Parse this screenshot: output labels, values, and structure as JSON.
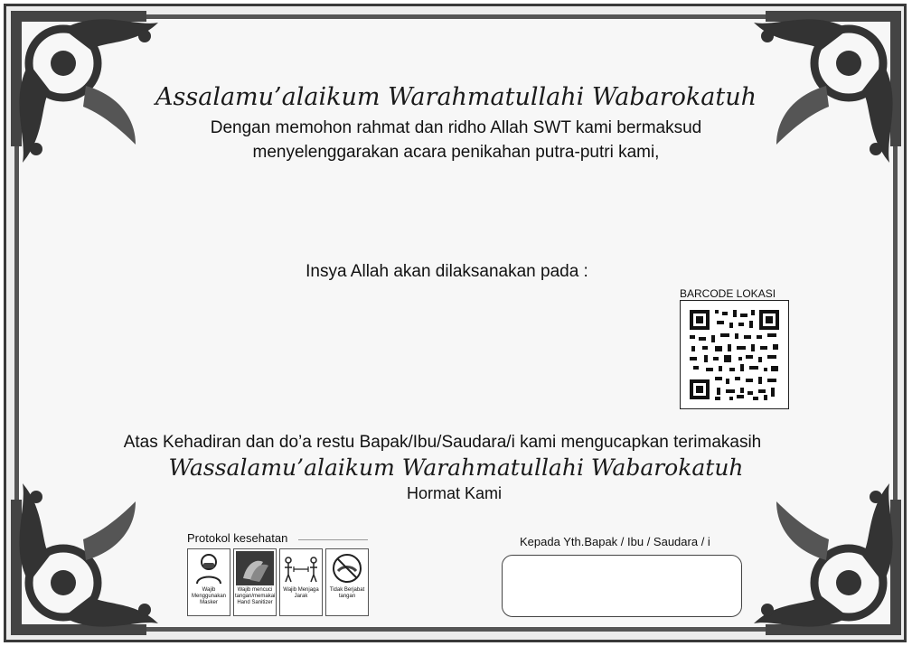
{
  "greeting_open": "Assalamu’alaikum Warahmatullahi Wabarokatuh",
  "intro_line1": "Dengan memohon rahmat dan ridho Allah SWT kami bermaksud",
  "intro_line2": "menyelenggarakan acara penikahan putra-putri kami,",
  "schedule_intro": "Insya Allah akan dilaksanakan pada :",
  "barcode": {
    "label": "BARCODE LOKASI"
  },
  "closing_line": "Atas Kehadiran dan do’a restu Bapak/Ibu/Saudara/i kami mengucapkan terimakasih",
  "greeting_close": "Wassalamu’alaikum Warahmatullahi Wabarokatuh",
  "signoff": "Hormat Kami",
  "protocol": {
    "title": "Protokol kesehatan",
    "items": [
      {
        "icon": "mask-icon",
        "caption": "Wajib Menggunakan Masker"
      },
      {
        "icon": "handwash-icon",
        "caption": "Wajib mencuci tangan/memakai Hand Sanitizer"
      },
      {
        "icon": "distance-icon",
        "caption": "Wajib Menjaga Jarak"
      },
      {
        "icon": "no-handshake-icon",
        "caption": "Tidak Berjabat tangan"
      }
    ]
  },
  "recipient": {
    "label": "Kepada Yth.Bapak / Ibu / Saudara / i"
  }
}
